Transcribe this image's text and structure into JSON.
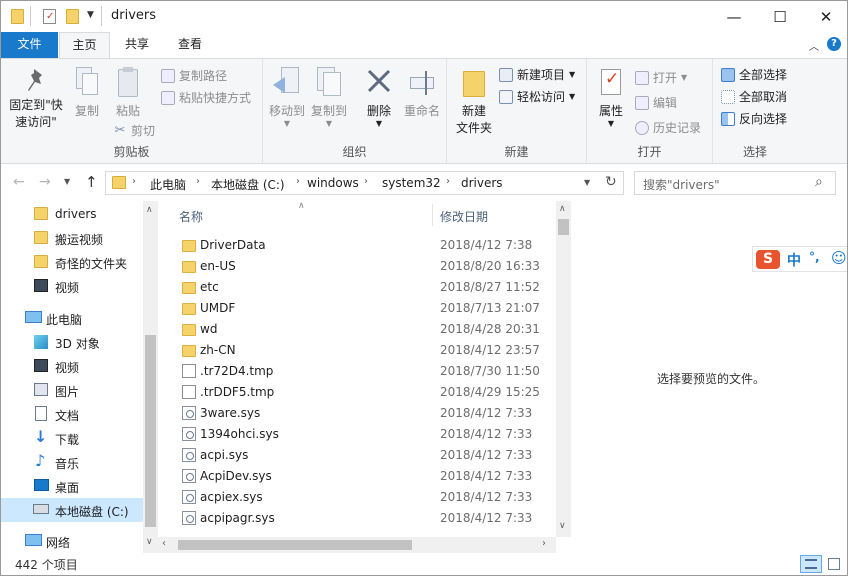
{
  "window": {
    "title": "drivers",
    "controls": {
      "minimize": "—",
      "maximize": "☐",
      "close": "✕"
    }
  },
  "ribbon": {
    "tabs": [
      {
        "label": "文件"
      },
      {
        "label": "主页"
      },
      {
        "label": "共享"
      },
      {
        "label": "查看"
      }
    ],
    "clipboard": {
      "group_label": "剪贴板",
      "pin_label": "固定到\"快\n速访问\"",
      "copy_label": "复制",
      "paste_label": "粘贴",
      "copy_path": "复制路径",
      "paste_shortcut": "粘贴快捷方式",
      "cut": "剪切"
    },
    "organize": {
      "group_label": "组织",
      "move_to": "移动到",
      "copy_to": "复制到",
      "delete": "删除",
      "rename": "重命名"
    },
    "new": {
      "group_label": "新建",
      "new_folder": "新建\n文件夹",
      "new_item": "新建项目",
      "easy_access": "轻松访问"
    },
    "open": {
      "group_label": "打开",
      "properties": "属性",
      "open": "打开",
      "edit": "编辑",
      "history": "历史记录"
    },
    "select": {
      "group_label": "选择",
      "select_all": "全部选择",
      "select_none": "全部取消",
      "invert": "反向选择"
    }
  },
  "address": {
    "crumbs": [
      "此电脑",
      "本地磁盘 (C:)",
      "windows",
      "system32",
      "drivers"
    ],
    "search_placeholder": "搜索\"drivers\""
  },
  "nav": {
    "quick": [
      {
        "label": "drivers",
        "icon": "folder-icon"
      },
      {
        "label": "搬运视频",
        "icon": "folder-icon"
      },
      {
        "label": "奇怪的文件夹",
        "icon": "folder-icon"
      },
      {
        "label": "视频",
        "icon": "video-icon"
      }
    ],
    "this_pc": "此电脑",
    "pc_items": [
      {
        "label": "3D 对象",
        "icon": "3d-objects-icon"
      },
      {
        "label": "视频",
        "icon": "video-icon"
      },
      {
        "label": "图片",
        "icon": "pictures-icon"
      },
      {
        "label": "文档",
        "icon": "documents-icon"
      },
      {
        "label": "下载",
        "icon": "download-icon"
      },
      {
        "label": "音乐",
        "icon": "music-icon"
      },
      {
        "label": "桌面",
        "icon": "desktop-icon"
      },
      {
        "label": "本地磁盘 (C:)",
        "icon": "drive-icon"
      }
    ],
    "network": "网络"
  },
  "list": {
    "col_name": "名称",
    "col_date": "修改日期",
    "files": [
      {
        "name": "DriverData",
        "date": "2018/4/12 7:38",
        "type": "folder"
      },
      {
        "name": "en-US",
        "date": "2018/8/20 16:33",
        "type": "folder"
      },
      {
        "name": "etc",
        "date": "2018/8/27 11:52",
        "type": "folder"
      },
      {
        "name": "UMDF",
        "date": "2018/7/13 21:07",
        "type": "folder"
      },
      {
        "name": "wd",
        "date": "2018/4/28 20:31",
        "type": "folder"
      },
      {
        "name": "zh-CN",
        "date": "2018/4/12 23:57",
        "type": "folder"
      },
      {
        "name": ".tr72D4.tmp",
        "date": "2018/7/30 11:50",
        "type": "file"
      },
      {
        "name": ".trDDF5.tmp",
        "date": "2018/4/29 15:25",
        "type": "file"
      },
      {
        "name": "3ware.sys",
        "date": "2018/4/12 7:33",
        "type": "sys"
      },
      {
        "name": "1394ohci.sys",
        "date": "2018/4/12 7:33",
        "type": "sys"
      },
      {
        "name": "acpi.sys",
        "date": "2018/4/12 7:33",
        "type": "sys"
      },
      {
        "name": "AcpiDev.sys",
        "date": "2018/4/12 7:33",
        "type": "sys"
      },
      {
        "name": "acpiex.sys",
        "date": "2018/4/12 7:33",
        "type": "sys"
      },
      {
        "name": "acpipagr.sys",
        "date": "2018/4/12 7:33",
        "type": "sys"
      }
    ]
  },
  "preview": {
    "message": "选择要预览的文件。"
  },
  "status": {
    "count": "442 个项目"
  },
  "ime": {
    "mode": "中",
    "punct": "°,",
    "logo": "S"
  },
  "colors": {
    "accent": "#1979ca",
    "folder": "#f5d36a",
    "selected_nav": "#cce8ff"
  }
}
